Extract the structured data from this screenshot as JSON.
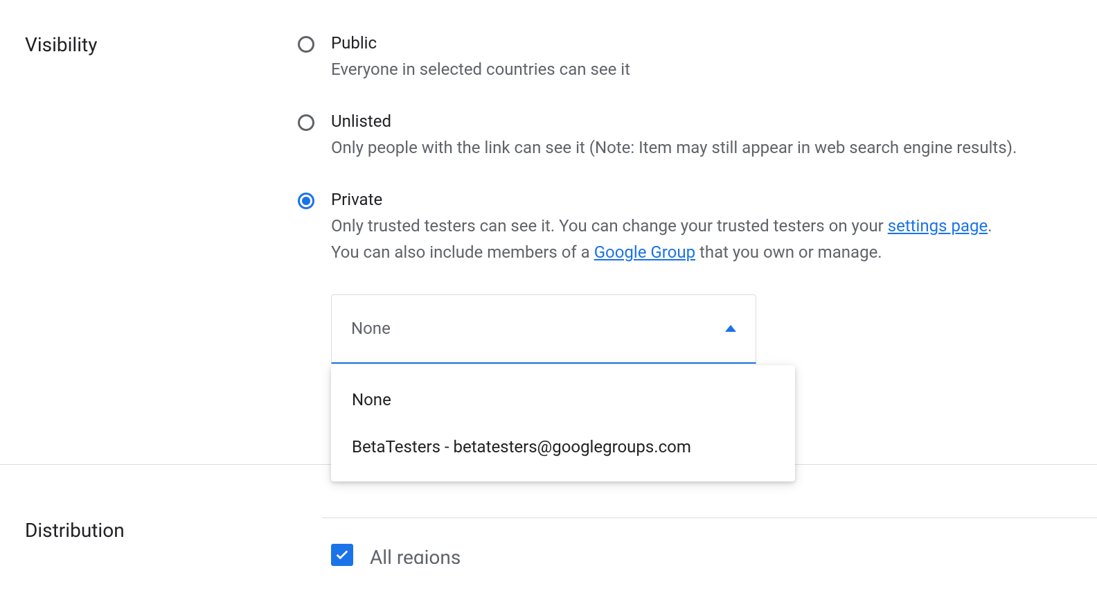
{
  "visibility": {
    "section_label": "Visibility",
    "options": [
      {
        "label": "Public",
        "description": "Everyone in selected countries can see it",
        "selected": false
      },
      {
        "label": "Unlisted",
        "description": "Only people with the link can see it (Note: Item may still appear in web search engine results).",
        "selected": false
      },
      {
        "label": "Private",
        "description_part1": "Only trusted testers can see it. You can change your trusted testers on your ",
        "description_link1": "settings page",
        "description_part2": ".",
        "description_part3": "You can also include members of a ",
        "description_link2": "Google Group",
        "description_part4": " that you own or manage.",
        "selected": true
      }
    ],
    "dropdown": {
      "selected_value": "None",
      "options": [
        "None",
        "BetaTesters - betatesters@googlegroups.com"
      ]
    }
  },
  "distribution": {
    "section_label": "Distribution",
    "checkbox_label": "All regions",
    "checked": true
  }
}
